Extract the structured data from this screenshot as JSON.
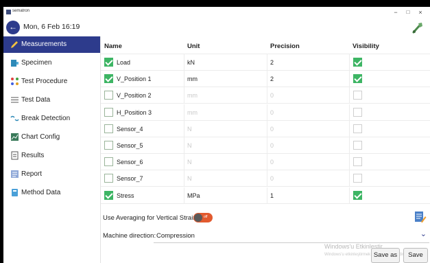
{
  "window": {
    "app_name": "sematron",
    "minimize": "−",
    "maximize": "□",
    "close": "×"
  },
  "header": {
    "datetime": "Mon, 6 Feb  16:19"
  },
  "sidebar": {
    "items": [
      {
        "label": "Measurements",
        "icon": "pencil-icon",
        "active": true
      },
      {
        "label": "Specimen",
        "icon": "specimen-icon"
      },
      {
        "label": "Test Procedure",
        "icon": "procedure-icon"
      },
      {
        "label": "Test Data",
        "icon": "list-icon"
      },
      {
        "label": "Break Detection",
        "icon": "break-icon"
      },
      {
        "label": "Chart Config",
        "icon": "chart-icon"
      },
      {
        "label": "Results",
        "icon": "results-icon"
      },
      {
        "label": "Report",
        "icon": "report-icon"
      },
      {
        "label": "Method Data",
        "icon": "method-icon"
      }
    ]
  },
  "table": {
    "headers": [
      "Name",
      "Unit",
      "Precision",
      "Visibility"
    ],
    "rows": [
      {
        "enabled": true,
        "name": "Load",
        "unit": "kN",
        "precision": "2",
        "visible": true
      },
      {
        "enabled": true,
        "name": "V_Position 1",
        "unit": "mm",
        "precision": "2",
        "visible": true
      },
      {
        "enabled": false,
        "name": "V_Position 2",
        "unit": "mm",
        "precision": "0",
        "visible": false
      },
      {
        "enabled": false,
        "name": "H_Position 3",
        "unit": "mm",
        "precision": "0",
        "visible": false
      },
      {
        "enabled": false,
        "name": "Sensor_4",
        "unit": "N",
        "precision": "0",
        "visible": false
      },
      {
        "enabled": false,
        "name": "Sensor_5",
        "unit": "N",
        "precision": "0",
        "visible": false
      },
      {
        "enabled": false,
        "name": "Sensor_6",
        "unit": "N",
        "precision": "0",
        "visible": false
      },
      {
        "enabled": false,
        "name": "Sensor_7",
        "unit": "N",
        "precision": "0",
        "visible": false
      },
      {
        "enabled": true,
        "name": "Stress",
        "unit": "MPa",
        "precision": "1",
        "visible": true
      }
    ]
  },
  "averaging": {
    "label": "Use Averaging for Vertical Strain",
    "toggle_text": "off"
  },
  "machine_direction": {
    "label": "Machine direction:",
    "value": "Compression"
  },
  "watermark": {
    "line1": "Windows'u Etkinleştir",
    "line2": "Windows'u etkinleştirmek için Ayarlar'a gidin."
  },
  "buttons": {
    "save_as": "Save as",
    "save": "Save"
  },
  "colors": {
    "accent": "#2d3b8c",
    "check_green": "#3db564",
    "toggle_orange": "#e25a2f"
  }
}
